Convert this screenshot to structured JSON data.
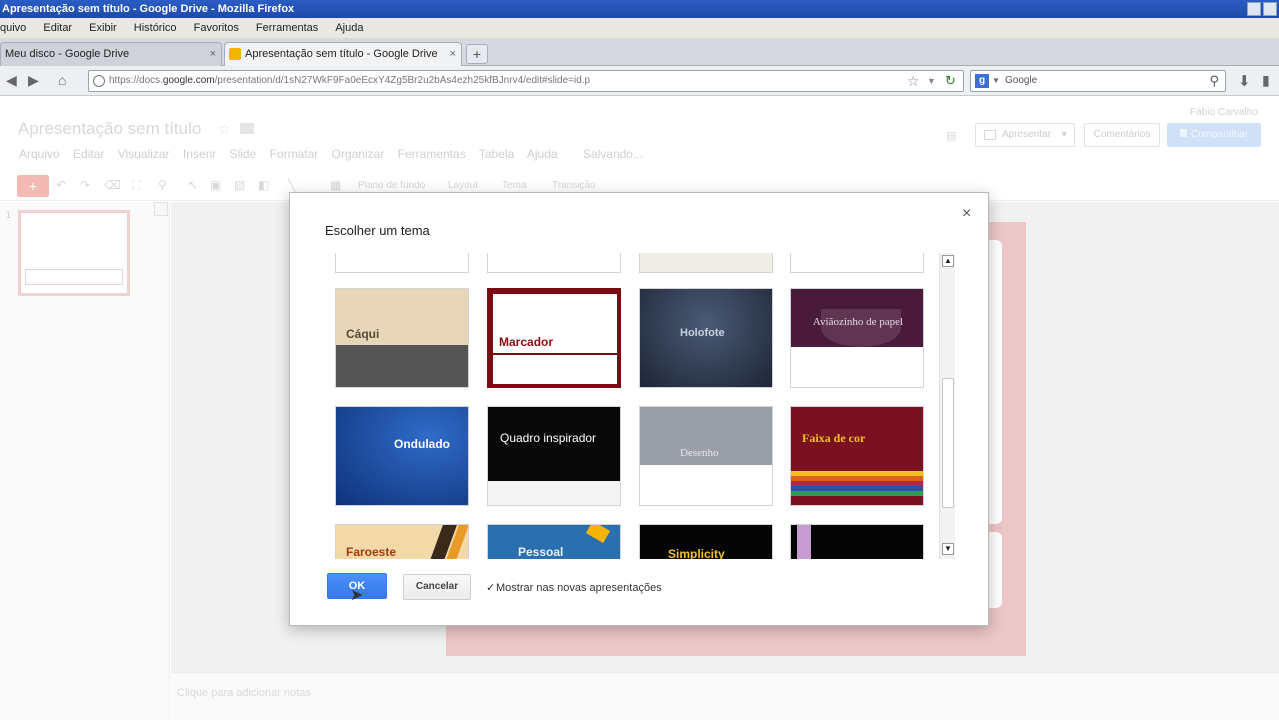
{
  "window": {
    "title": "Apresentação sem título - Google Drive - Mozilla Firefox"
  },
  "menubar": [
    "quivo",
    "Editar",
    "Exibir",
    "Histórico",
    "Favoritos",
    "Ferramentas",
    "Ajuda"
  ],
  "tabs": [
    {
      "label": "Meu disco - Google Drive",
      "close": "×"
    },
    {
      "label": "Apresentação sem título - Google Drive",
      "close": "×"
    }
  ],
  "newtab": "+",
  "address": {
    "prefix": "https://docs.",
    "host": "google.com",
    "path": "/presentation/d/1sN27WkF9Fa0eEcxY4Zg5Br2u2bAs4ezh25kfBJnrv4/edit#slide=id.p"
  },
  "search": {
    "engine": "g",
    "placeholder": "Google"
  },
  "app": {
    "doc_title": "Apresentação sem título",
    "menus": [
      "Arquivo",
      "Editar",
      "Visualizar",
      "Inserir",
      "Slide",
      "Formatar",
      "Organizar",
      "Ferramentas",
      "Tabela",
      "Ajuda",
      "Salvando..."
    ],
    "user": "Fábio Carvalho",
    "present_label": "Apresentar",
    "comments_label": "Comentários",
    "share_label": "Compartilhar",
    "toolbar_texts": [
      "Plano de fundo",
      "Layout",
      "Tema",
      "Transição"
    ],
    "slide_number": "1",
    "notes_placeholder": "Clique para adicionar notas"
  },
  "dialog": {
    "title": "Escolher um tema",
    "close": "×",
    "themes": [
      {
        "name": "Cáqui",
        "top": "#e8d6b8",
        "bottom": "#555555",
        "text_color": "#5a4a35"
      },
      {
        "name": "Marcador",
        "frame": "#7a0b10",
        "text_color": "#8b0d12"
      },
      {
        "name": "Holofote",
        "bg": "#2c3a52",
        "text_color": "#c9d2de"
      },
      {
        "name": "Aviãozinho de papel",
        "bg": "#4a1a3a",
        "text_color": "#e8d6e2"
      },
      {
        "name": "Ondulado",
        "bg": "#1f4fa0",
        "text_color": "#ffffff"
      },
      {
        "name": "Quadro inspirador",
        "bg": "#080808",
        "text_color": "#ffffff"
      },
      {
        "name": "Desenho",
        "bg": "#9a9ea6",
        "text_color": "#e8e8e8"
      },
      {
        "name": "Faixa de cor",
        "bg": "#7a1020",
        "text_color": "#f4c020"
      },
      {
        "name": "Faroeste",
        "bg": "#f4d9a8",
        "text_color": "#a23b12"
      },
      {
        "name": "Pessoal",
        "bg": "#2a6fb0",
        "text_color": "#e8f0ff"
      },
      {
        "name": "Simplicity",
        "bg": "#050505",
        "text_color": "#f1c232"
      },
      {
        "name": "",
        "bg": "#050505",
        "accent": "#c79ad0"
      }
    ],
    "ok_label": "OK",
    "cancel_label": "Cancelar",
    "checkbox_label": "Mostrar nas novas apresentações",
    "checkbox_checked": true
  },
  "icons": {
    "back": "back-arrow-icon",
    "forward": "forward-arrow-icon",
    "star": "star-icon",
    "refresh": "refresh-icon",
    "search": "search-icon",
    "download": "download-icon"
  }
}
